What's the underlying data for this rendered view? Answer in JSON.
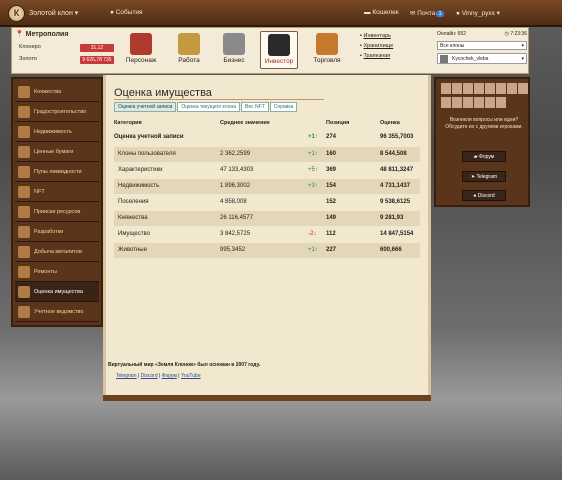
{
  "topbar": {
    "brand": "Золотой клон",
    "events": "События",
    "wallet": "Кошелек",
    "mail": "Почта",
    "mail_count": "1",
    "user": "Vinny_pyxx"
  },
  "header": {
    "location": "Метрополия",
    "resources": [
      {
        "name": "Клонеро",
        "value": "31,12"
      },
      {
        "name": "Золото",
        "value": "9 626,78 735"
      }
    ],
    "nav": [
      {
        "label": "Персонаж",
        "color": "#b03a2e"
      },
      {
        "label": "Работа",
        "color": "#c49a3e"
      },
      {
        "label": "Бизнес",
        "color": "#8a8a8a"
      },
      {
        "label": "Инвестор",
        "color": "#2a2a2a"
      },
      {
        "label": "Торговля",
        "color": "#c47a2a"
      }
    ],
    "storage": [
      "Инвентарь",
      "Хранилище",
      "Трапезная"
    ],
    "online": "Онлайн: 652",
    "time": "7:23:36",
    "clone_select": "Все клоны",
    "user_select": "Kycochek_vleba"
  },
  "sidebar": {
    "items": [
      "Княжества",
      "Градостроительство",
      "Недвижимость",
      "Ценные бумаги",
      "Пулы ликвидности",
      "NFT",
      "Прииски ресурсов",
      "Разработки",
      "Добыча мегалитов",
      "Ремонты",
      "Оценка имущества",
      "Учетное ведомство"
    ]
  },
  "main": {
    "title": "Оценка имущества",
    "tabs": [
      "Оценка учетной записи",
      "Оценка текущего клона",
      "Вес NFT",
      "Справка"
    ],
    "columns": [
      "Категория",
      "Среднее значение",
      "Позиция",
      "Оценка"
    ],
    "total": {
      "category": "Оценка учетной записи",
      "change": "+1↑",
      "position": "274",
      "value": "96 355,7003"
    },
    "rows": [
      {
        "category": "Клоны пользователя",
        "avg": "2 362,2599",
        "change": "+1↑",
        "position": "160",
        "value": "8 544,508"
      },
      {
        "category": "Характеристики",
        "avg": "47 133,4303",
        "change": "+5↑",
        "position": "369",
        "value": "48 811,3247"
      },
      {
        "category": "Недвижимость",
        "avg": "1 896,3002",
        "change": "+3↑",
        "position": "154",
        "value": "4 731,1437"
      },
      {
        "category": "Поселения",
        "avg": "4 858,008",
        "change": "",
        "position": "152",
        "value": "9 538,6125"
      },
      {
        "category": "Княжества",
        "avg": "26 116,4577",
        "change": "",
        "position": "149",
        "value": "9 281,93"
      },
      {
        "category": "Имущество",
        "avg": "3 842,5725",
        "change": "-2↓",
        "position": "112",
        "value": "14 847,5154"
      },
      {
        "category": "Животные",
        "avg": "995,3452",
        "change": "+1↑",
        "position": "227",
        "value": "600,666"
      }
    ]
  },
  "footer": {
    "text": "Виртуальный мир «Земля Клонов» был основан в 2007 году.",
    "links": [
      "Telegram",
      "Discord",
      "Форум",
      "YouTube"
    ]
  },
  "right": {
    "text": "Возникли вопросы или идеи? Обсудите их с другими игроками.",
    "buttons": [
      "Форум",
      "Telegram",
      "Discord"
    ]
  }
}
